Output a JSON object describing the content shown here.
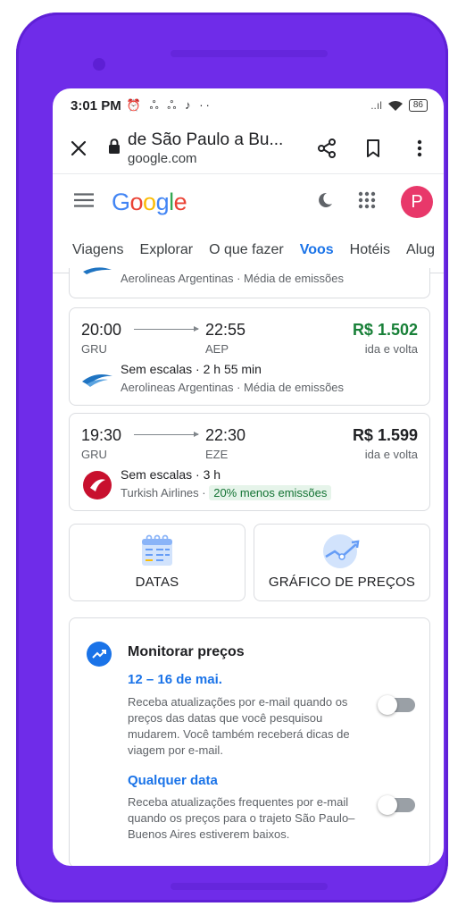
{
  "status_bar": {
    "time": "3:01 PM",
    "notif_icons": "⏰ ஃ ஃ ♪ ··",
    "signal": "..ıl",
    "battery": "86"
  },
  "url_bar": {
    "page_title": "de São Paulo a Bu...",
    "domain": "google.com"
  },
  "google_header": {
    "logo_letters": [
      {
        "ch": "G",
        "color": "#4285F4"
      },
      {
        "ch": "o",
        "color": "#EA4335"
      },
      {
        "ch": "o",
        "color": "#FBBC05"
      },
      {
        "ch": "g",
        "color": "#4285F4"
      },
      {
        "ch": "l",
        "color": "#34A853"
      },
      {
        "ch": "e",
        "color": "#EA4335"
      }
    ],
    "avatar_letter": "P"
  },
  "tabs": [
    {
      "label": "Viagens",
      "active": false
    },
    {
      "label": "Explorar",
      "active": false
    },
    {
      "label": "O que fazer",
      "active": false
    },
    {
      "label": "Voos",
      "active": true
    },
    {
      "label": "Hotéis",
      "active": false
    },
    {
      "label": "Alug",
      "active": false
    }
  ],
  "partial_flight": {
    "airline_line": "Aerolineas Argentinas · Média de emissões"
  },
  "flights": [
    {
      "dep_time": "20:00",
      "arr_time": "22:55",
      "dep_code": "GRU",
      "arr_code": "AEP",
      "price": "R$ 1.502",
      "price_color": "#188038",
      "price_type": "ida e volta",
      "stops": "Sem escalas · 2 h 55 min",
      "airline": "Aerolineas Argentinas · ",
      "emissions": "Média de emissões",
      "emissions_badge": false,
      "logo_icon": "aerolineas-argentinas-logo-icon"
    },
    {
      "dep_time": "19:30",
      "arr_time": "22:30",
      "dep_code": "GRU",
      "arr_code": "EZE",
      "price": "R$ 1.599",
      "price_color": "#202124",
      "price_type": "ida e volta",
      "stops": "Sem escalas · 3 h",
      "airline": "Turkish Airlines · ",
      "emissions": "20% menos emissões",
      "emissions_badge": true,
      "logo_icon": "turkish-airlines-logo-icon"
    }
  ],
  "tiles": {
    "dates_label": "DATAS",
    "price_graph_label": "GRÁFICO DE PREÇOS"
  },
  "monitor": {
    "title": "Monitorar preços",
    "option1_title": "12 – 16 de mai.",
    "option1_desc": "Receba atualizações por e-mail quando os preços das datas que você pesquisou mudarem. Você também receberá dicas de viagem por e-mail.",
    "option1_on": false,
    "option2_title": "Qualquer data",
    "option2_desc": "Receba atualizações frequentes por e-mail quando os preços para o trajeto São Paulo–Buenos Aires estiverem baixos.",
    "option2_on": false
  }
}
